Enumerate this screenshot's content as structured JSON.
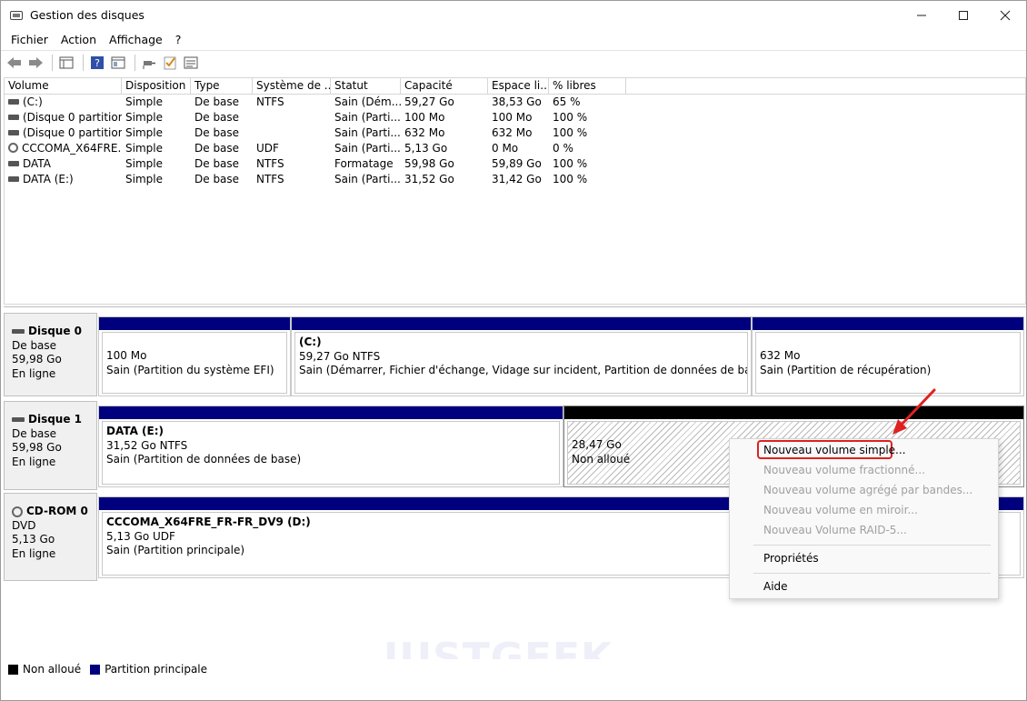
{
  "window": {
    "title": "Gestion des disques"
  },
  "menu": [
    "Fichier",
    "Action",
    "Affichage",
    "?"
  ],
  "list": {
    "columns": [
      "Volume",
      "Disposition",
      "Type",
      "Système de ...",
      "Statut",
      "Capacité",
      "Espace li...",
      "% libres"
    ],
    "rows": [
      [
        "(C:)",
        "Simple",
        "De base",
        "NTFS",
        "Sain (Dém...",
        "59,27 Go",
        "38,53 Go",
        "65 %"
      ],
      [
        "(Disque 0 partition...",
        "Simple",
        "De base",
        "",
        "Sain (Parti...",
        "100 Mo",
        "100 Mo",
        "100 %"
      ],
      [
        "(Disque 0 partition...",
        "Simple",
        "De base",
        "",
        "Sain (Parti...",
        "632 Mo",
        "632 Mo",
        "100 %"
      ],
      [
        "CCCOMA_X64FRE...",
        "Simple",
        "De base",
        "UDF",
        "Sain (Parti...",
        "5,13 Go",
        "0 Mo",
        "0 %"
      ],
      [
        "DATA",
        "Simple",
        "De base",
        "NTFS",
        "Formatage",
        "59,98 Go",
        "59,89 Go",
        "100 %"
      ],
      [
        "DATA (E:)",
        "Simple",
        "De base",
        "NTFS",
        "Sain (Parti...",
        "31,52 Go",
        "31,42 Go",
        "100 %"
      ]
    ]
  },
  "disks": {
    "d0": {
      "name": "Disque 0",
      "type": "De base",
      "size": "59,98 Go",
      "status": "En ligne",
      "p1": {
        "size": "100 Mo",
        "desc": "Sain (Partition du système EFI)"
      },
      "p2": {
        "title": "(C:)",
        "size": "59,27 Go NTFS",
        "desc": "Sain (Démarrer, Fichier d'échange, Vidage sur incident, Partition de données de base)"
      },
      "p3": {
        "size": "632 Mo",
        "desc": "Sain (Partition de récupération)"
      }
    },
    "d1": {
      "name": "Disque 1",
      "type": "De base",
      "size": "59,98 Go",
      "status": "En ligne",
      "p1": {
        "title": "DATA  (E:)",
        "size": "31,52 Go NTFS",
        "desc": "Sain (Partition de données de base)"
      },
      "p2": {
        "size": "28,47 Go",
        "desc": "Non alloué"
      }
    },
    "cd0": {
      "name": "CD-ROM 0",
      "type": "DVD",
      "size": "5,13 Go",
      "status": "En ligne",
      "p1": {
        "title": "CCCOMA_X64FRE_FR-FR_DV9  (D:)",
        "size": "5,13 Go UDF",
        "desc": "Sain (Partition principale)"
      }
    }
  },
  "legend": {
    "unallocated": "Non alloué",
    "primary": "Partition principale"
  },
  "context_menu": {
    "new_simple": "Nouveau volume simple...",
    "new_spanned": "Nouveau volume fractionné...",
    "new_striped": "Nouveau volume agrégé par bandes...",
    "new_mirrored": "Nouveau volume en miroir...",
    "new_raid5": "Nouveau Volume RAID-5...",
    "properties": "Propriétés",
    "help": "Aide"
  },
  "watermark": "JUSTGEEK",
  "colors": {
    "partition_bar": "#00007f",
    "unallocated_bar": "#000000",
    "highlight": "#e02020"
  }
}
